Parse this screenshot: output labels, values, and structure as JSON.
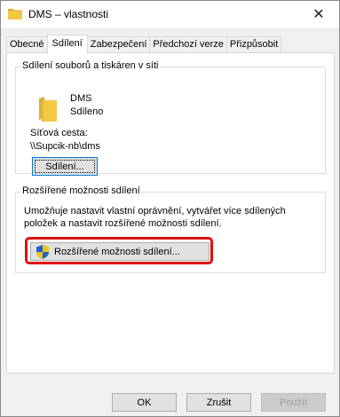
{
  "window": {
    "title": "DMS – vlastnosti",
    "close_glyph": "✕",
    "folder_color": "#f4c842"
  },
  "tabs": [
    {
      "label": "Obecné",
      "active": false
    },
    {
      "label": "Sdílení",
      "active": true
    },
    {
      "label": "Zabezpečení",
      "active": false
    },
    {
      "label": "Předchozí verze",
      "active": false
    },
    {
      "label": "Přizpůsobit",
      "active": false
    }
  ],
  "network_sharing": {
    "legend": "Sdílení souborů a tiskáren v síti",
    "folder_name": "DMS",
    "folder_status": "Sdíleno",
    "path_label": "Síťová cesta:",
    "path_value": "\\\\Supcik-nb\\dms",
    "share_button": "Sdílení..."
  },
  "advanced_sharing": {
    "legend": "Rozšířené možnosti sdílení",
    "description_line1": "Umožňuje nastavit vlastní oprávnění, vytvářet více sdílených",
    "description_line2": "položek a nastavit rozšířené možnosti sdílení.",
    "button": "Rozšířené možnosti sdílení...",
    "highlight_color": "#e01010"
  },
  "footer": {
    "ok": "OK",
    "cancel": "Zrušit",
    "apply": "Použít"
  }
}
